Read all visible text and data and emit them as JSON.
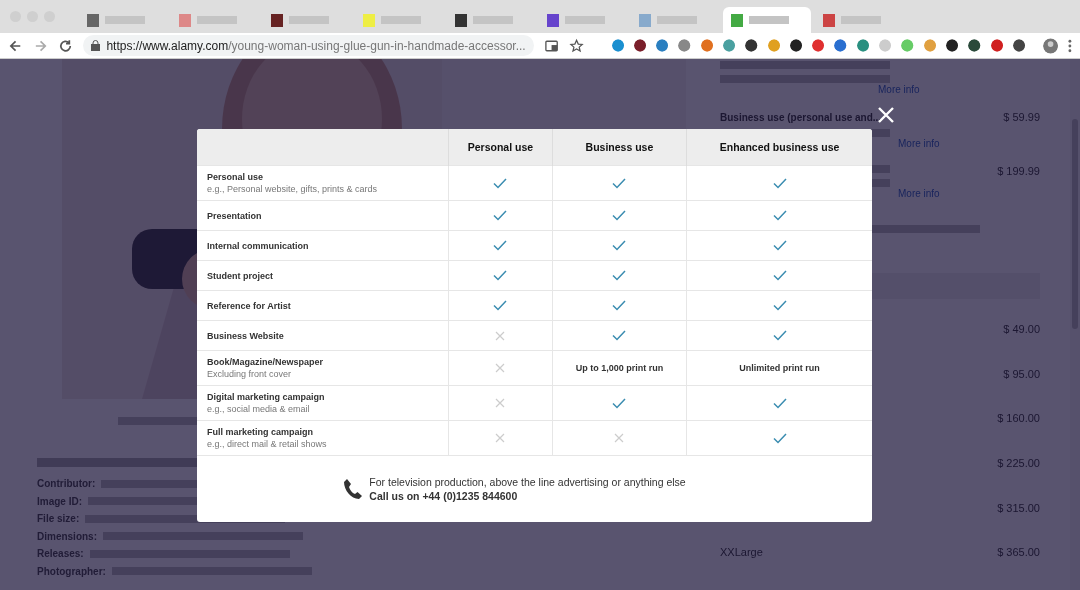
{
  "browser": {
    "tabs": [
      {
        "selected": false
      },
      {
        "selected": false
      },
      {
        "selected": false
      },
      {
        "selected": false
      },
      {
        "selected": false
      },
      {
        "selected": false
      },
      {
        "selected": false
      },
      {
        "selected": true
      },
      {
        "selected": false
      }
    ],
    "url": {
      "host": "https://www.alamy.com",
      "path": "/young-woman-using-glue-gun-in-handmade-accessor..."
    }
  },
  "page": {
    "details": [
      {
        "label": "Contributor:"
      },
      {
        "label": "Image ID:"
      },
      {
        "label": "File size:"
      },
      {
        "label": "Dimensions:"
      },
      {
        "label": "Releases:"
      },
      {
        "label": "Photographer:"
      }
    ],
    "licences": [
      {
        "link": "More info"
      },
      {
        "label": "Business use (personal use and...",
        "price": "$ 59.99",
        "link": "More info"
      },
      {
        "price": "$ 199.99",
        "link": "More info"
      }
    ],
    "sizes": [
      {
        "price": "$ 49.00"
      },
      {
        "price": "$ 95.00"
      },
      {
        "price": "$ 160.00"
      },
      {
        "price": "$ 225.00"
      },
      {
        "price": "$ 315.00"
      },
      {
        "label": "XXLarge",
        "price": "$ 365.00"
      }
    ]
  },
  "dialog": {
    "columns": [
      "Personal use",
      "Business use",
      "Enhanced business use"
    ],
    "rows": [
      {
        "label": "Personal use",
        "note": "e.g., Personal website, gifts, prints & cards",
        "cells": [
          {
            "kind": "check"
          },
          {
            "kind": "check"
          },
          {
            "kind": "check"
          }
        ]
      },
      {
        "label": "Presentation",
        "cells": [
          {
            "kind": "check"
          },
          {
            "kind": "check"
          },
          {
            "kind": "check"
          }
        ]
      },
      {
        "label": "Internal communication",
        "cells": [
          {
            "kind": "check"
          },
          {
            "kind": "check"
          },
          {
            "kind": "check"
          }
        ]
      },
      {
        "label": "Student project",
        "cells": [
          {
            "kind": "check"
          },
          {
            "kind": "check"
          },
          {
            "kind": "check"
          }
        ]
      },
      {
        "label": "Reference for Artist",
        "cells": [
          {
            "kind": "check"
          },
          {
            "kind": "check"
          },
          {
            "kind": "check"
          }
        ]
      },
      {
        "label": "Business Website",
        "cells": [
          {
            "kind": "cross"
          },
          {
            "kind": "check"
          },
          {
            "kind": "check"
          }
        ]
      },
      {
        "label": "Book/Magazine/Newspaper",
        "note": "Excluding front cover",
        "cells": [
          {
            "kind": "cross"
          },
          {
            "kind": "text",
            "text": "Up to 1,000 print run"
          },
          {
            "kind": "text",
            "text": "Unlimited print run"
          }
        ]
      },
      {
        "label": "Digital marketing campaign",
        "note": "e.g., social media & email",
        "cells": [
          {
            "kind": "cross"
          },
          {
            "kind": "check"
          },
          {
            "kind": "check"
          }
        ]
      },
      {
        "label": "Full marketing campaign",
        "note": "e.g., direct mail & retail shows",
        "cells": [
          {
            "kind": "cross"
          },
          {
            "kind": "cross"
          },
          {
            "kind": "check"
          }
        ]
      }
    ],
    "footer": {
      "text": "For television production, above the line advertising or anything else",
      "call": "Call us on +44 (0)1235 844600"
    }
  }
}
